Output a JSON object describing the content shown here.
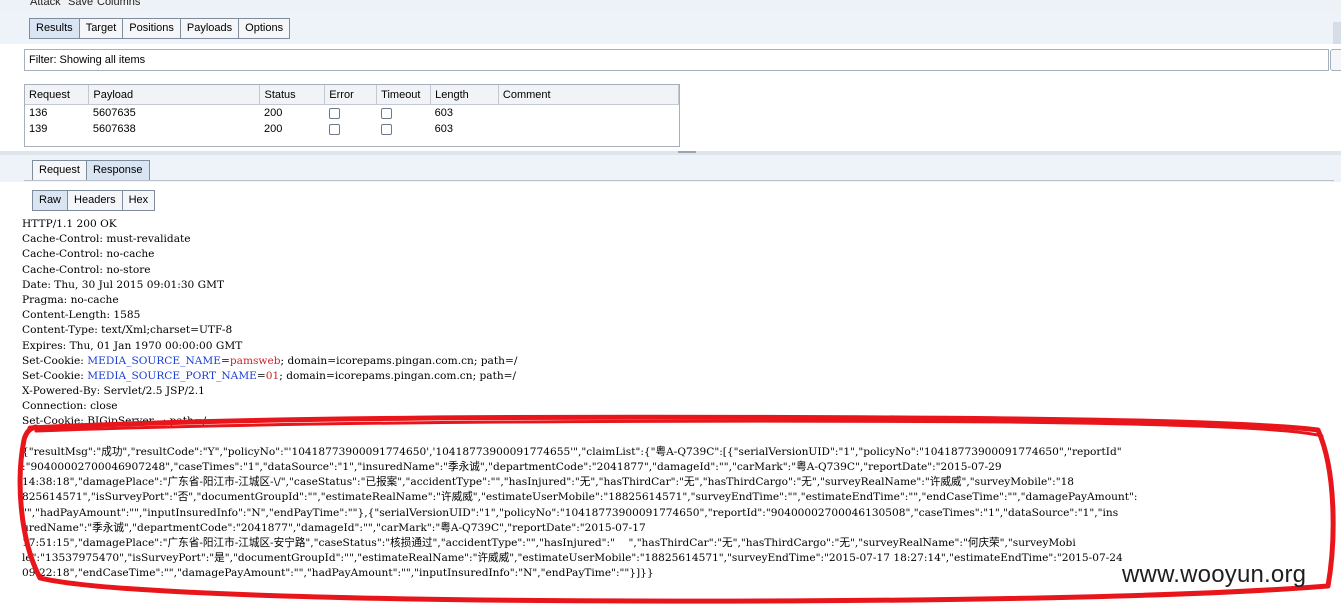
{
  "menu": {
    "items": [
      "Attack",
      "Save",
      "Columns"
    ]
  },
  "main_tabs": [
    {
      "label": "Results",
      "active": true
    },
    {
      "label": "Target",
      "active": false
    },
    {
      "label": "Positions",
      "active": false
    },
    {
      "label": "Payloads",
      "active": false
    },
    {
      "label": "Options",
      "active": false
    }
  ],
  "filter": {
    "text": "Filter: Showing all items"
  },
  "results_table": {
    "columns": [
      "Request",
      "Payload",
      "Status",
      "Error",
      "Timeout",
      "Length",
      "Comment"
    ],
    "rows": [
      {
        "request": "136",
        "payload": "5607635",
        "status": "200",
        "error": false,
        "timeout": false,
        "length": "603",
        "comment": ""
      },
      {
        "request": "139",
        "payload": "5607638",
        "status": "200",
        "error": false,
        "timeout": false,
        "length": "603",
        "comment": ""
      }
    ]
  },
  "message_tabs": [
    {
      "label": "Request",
      "active": false
    },
    {
      "label": "Response",
      "active": true
    }
  ],
  "view_tabs": [
    {
      "label": "Raw",
      "active": true
    },
    {
      "label": "Headers",
      "active": false
    },
    {
      "label": "Hex",
      "active": false
    }
  ],
  "response": {
    "headers": [
      "HTTP/1.1 200 OK",
      "Cache-Control: must-revalidate",
      "Cache-Control: no-cache",
      "Cache-Control: no-store",
      "Date: Thu, 30 Jul 2015 09:01:30 GMT",
      "Pragma: no-cache",
      "Content-Length: 1585",
      "Content-Type: text/Xml;charset=UTF-8",
      "Expires: Thu, 01 Jan 1970 00:00:00 GMT"
    ],
    "cookie1": {
      "prefix": "Set-Cookie: ",
      "name": "MEDIA_SOURCE_NAME",
      "eq": "=",
      "value": "pamsweb",
      "rest": "; domain=icorepams.pingan.com.cn; path=/"
    },
    "cookie2": {
      "prefix": "Set-Cookie: ",
      "name": "MEDIA_SOURCE_PORT_NAME",
      "eq": "=",
      "value": "01",
      "rest": "; domain=icorepams.pingan.com.cn; path=/"
    },
    "powered_by": "X-Powered-By: Servlet/2.5 JSP/2.1",
    "connection": "Connection: close",
    "cookie3": "Set-Cookie: BIGipServer...; path=/",
    "body_lines": [
      "{\"resultMsg\":\"成功\",\"resultCode\":\"Y\",\"policyNo\":\"'10418773900091774650','10418773900091774655'\",\"claimList\":{\"粤A-Q739C\":[{\"serialVersionUID\":\"1\",\"policyNo\":\"10418773900091774650\",\"reportId\"",
      ":\"90400002700046907248\",\"caseTimes\":\"1\",\"dataSource\":\"1\",\"insuredName\":\"季永诚\",\"departmentCode\":\"2041877\",\"damageId\":\"\",\"carMark\":\"粤A-Q739C\",\"reportDate\":\"2015-07-29",
      "14:38:18\",\"damagePlace\":\"广东省-阳江市-江城区-\\/\",\"caseStatus\":\"已报案\",\"accidentType\":\"\",\"hasInjured\":\"无\",\"hasThirdCar\":\"无\",\"hasThirdCargo\":\"无\",\"surveyRealName\":\"许威威\",\"surveyMobile\":\"18",
      "825614571\",\"isSurveyPort\":\"否\",\"documentGroupId\":\"\",\"estimateRealName\":\"许威威\",\"estimateUserMobile\":\"18825614571\",\"surveyEndTime\":\"\",\"estimateEndTime\":\"\",\"endCaseTime\":\"\",\"damagePayAmount\":",
      "\"\",\"hadPayAmount\":\"\",\"inputInsuredInfo\":\"N\",\"endPayTime\":\"\"},{\"serialVersionUID\":\"1\",\"policyNo\":\"10418773900091774650\",\"reportId\":\"90400002700046130508\",\"caseTimes\":\"1\",\"dataSource\":\"1\",\"ins",
      "uredName\":\"季永诚\",\"departmentCode\":\"2041877\",\"damageId\":\"\",\"carMark\":\"粤A-Q739C\",\"reportDate\":\"2015-07-17",
      "17:51:15\",\"damagePlace\":\"广东省-阳江市-江城区-安宁路\",\"caseStatus\":\"核损通过\",\"accidentType\":\"\",\"hasInjured\":\"    \",\"hasThirdCar\":\"无\",\"hasThirdCargo\":\"无\",\"surveyRealName\":\"何庆荣\",\"surveyMobi",
      "le\":\"13537975470\",\"isSurveyPort\":\"是\",\"documentGroupId\":\"\",\"estimateRealName\":\"许威威\",\"estimateUserMobile\":\"18825614571\",\"surveyEndTime\":\"2015-07-17 18:27:14\",\"estimateEndTime\":\"2015-07-24",
      "09:22:18\",\"endCaseTime\":\"\",\"damagePayAmount\":\"\",\"hadPayAmount\":\"\",\"inputInsuredInfo\":\"N\",\"endPayTime\":\"\"}]}}"
    ]
  },
  "watermark": {
    "text": "www.wooyun.org"
  },
  "colors": {
    "highlight_key": "#1a3cd4",
    "highlight_value": "#c8242c",
    "scribble": "#e8151b"
  }
}
